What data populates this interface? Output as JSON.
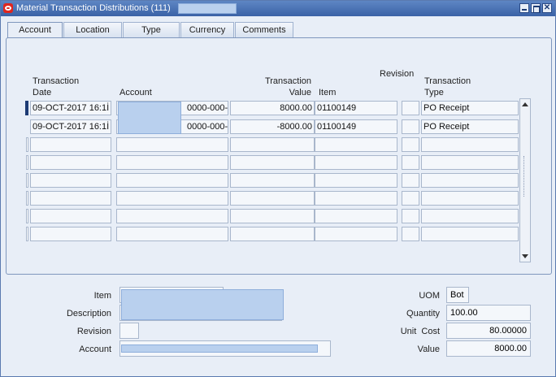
{
  "window": {
    "title": "Material Transaction Distributions (111)"
  },
  "tabs": [
    "Account",
    "Location",
    "Type",
    "Currency",
    "Comments"
  ],
  "columns": {
    "transaction_date": [
      "Transaction",
      "Date"
    ],
    "account": "Account",
    "transaction_value": [
      "Transaction",
      "Value"
    ],
    "item": "Item",
    "revision": "Revision",
    "transaction_type": [
      "Transaction",
      "Type"
    ]
  },
  "rows": [
    {
      "date": "09-OCT-2017 16:1İ",
      "account_suffix": "0000-000-0",
      "value": "8000.00",
      "item": "01100149",
      "revision": "",
      "type": "PO Receipt"
    },
    {
      "date": "09-OCT-2017 16:1İ",
      "account_suffix": "0000-000-0",
      "value": "-8000.00",
      "item": "01100149",
      "revision": "",
      "type": "PO Receipt"
    }
  ],
  "details": {
    "item_label": "Item",
    "description_label": "Description",
    "revision_label": "Revision",
    "account_label": "Account",
    "uom_label": "UOM",
    "uom": "Bot",
    "quantity_label": "Quantity",
    "quantity": "100.00",
    "unit_cost_label": "Unit  Cost",
    "unit_cost": "80.00000",
    "value_label": "Value",
    "value": "8000.00"
  }
}
